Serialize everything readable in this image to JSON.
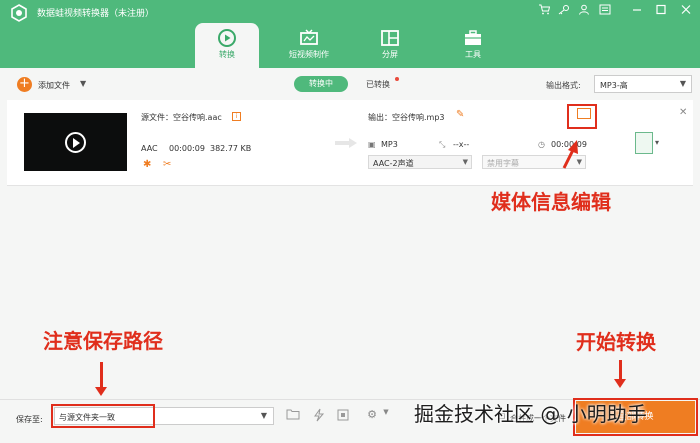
{
  "app": {
    "title": "数据蛙视频转换器（未注册）",
    "window_controls": [
      "cart-icon",
      "key-icon",
      "user-icon",
      "menu-icon",
      "minimize-icon",
      "maximize-icon",
      "close-icon"
    ]
  },
  "tabs": [
    {
      "label": "转换",
      "icon": "convert-icon",
      "active": true
    },
    {
      "label": "短视频制作",
      "icon": "tv-icon",
      "active": false
    },
    {
      "label": "分屏",
      "icon": "split-icon",
      "active": false
    },
    {
      "label": "工具",
      "icon": "toolbox-icon",
      "active": false
    }
  ],
  "toolbar": {
    "add_file": "添加文件",
    "converting": "转换中",
    "converted": "已转换",
    "output_format_label": "输出格式:",
    "output_format_value": "MP3-高"
  },
  "file": {
    "source_label": "源文件：空谷传响.aac",
    "source_format": "AAC",
    "duration": "00:00:09",
    "size": "382.77 KB",
    "output_label": "输出：空谷传响.mp3",
    "output_format": "MP3",
    "resolution": "--x--",
    "output_duration": "00:00:09",
    "audio_channel": "AAC-2声道",
    "subtitle": "禁用字幕"
  },
  "bottom": {
    "save_label": "保存至:",
    "save_path": "与源文件夹一致",
    "merge_label": "合并成一个文件",
    "convert_button": "全部转换"
  },
  "annotations": {
    "media_edit": "媒体信息编辑",
    "save_path_note": "注意保存路径",
    "start_convert": "开始转换",
    "accent": "#e02e1c"
  },
  "watermark": {
    "text": "掘金技术社区",
    "author": "@ 小明助手"
  },
  "colors": {
    "header_green": "#4fb97c",
    "accent_orange": "#ef7d22"
  }
}
